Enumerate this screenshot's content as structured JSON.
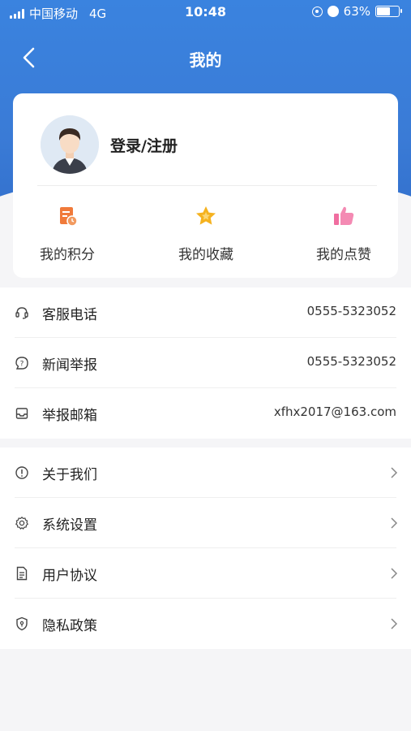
{
  "status_bar": {
    "carrier": "中国移动",
    "network": "4G",
    "time": "10:48",
    "battery_percent": "63%",
    "battery_level": 0.63
  },
  "nav": {
    "title": "我的",
    "back_icon": "chevron-left-icon"
  },
  "profile": {
    "login_label": "登录/注册",
    "avatar_icon": "user-avatar"
  },
  "quick_actions": [
    {
      "label": "我的积分",
      "icon": "points-icon",
      "color": "#f07a3a"
    },
    {
      "label": "我的收藏",
      "icon": "star-icon",
      "color": "#f5b21f"
    },
    {
      "label": "我的点赞",
      "icon": "thumbs-up-icon",
      "color": "#f06ea0"
    }
  ],
  "contact_list": [
    {
      "label": "客服电话",
      "value": "0555-5323052",
      "icon": "headset-icon"
    },
    {
      "label": "新闻举报",
      "value": "0555-5323052",
      "icon": "question-bubble-icon"
    },
    {
      "label": "举报邮箱",
      "value": "xfhx2017@163.com",
      "icon": "inbox-icon"
    }
  ],
  "settings_list": [
    {
      "label": "关于我们",
      "icon": "info-icon"
    },
    {
      "label": "系统设置",
      "icon": "gear-icon"
    },
    {
      "label": "用户协议",
      "icon": "document-icon"
    },
    {
      "label": "隐私政策",
      "icon": "shield-icon"
    }
  ],
  "colors": {
    "header_blue": "#3a83df",
    "background": "#f5f5f7"
  }
}
